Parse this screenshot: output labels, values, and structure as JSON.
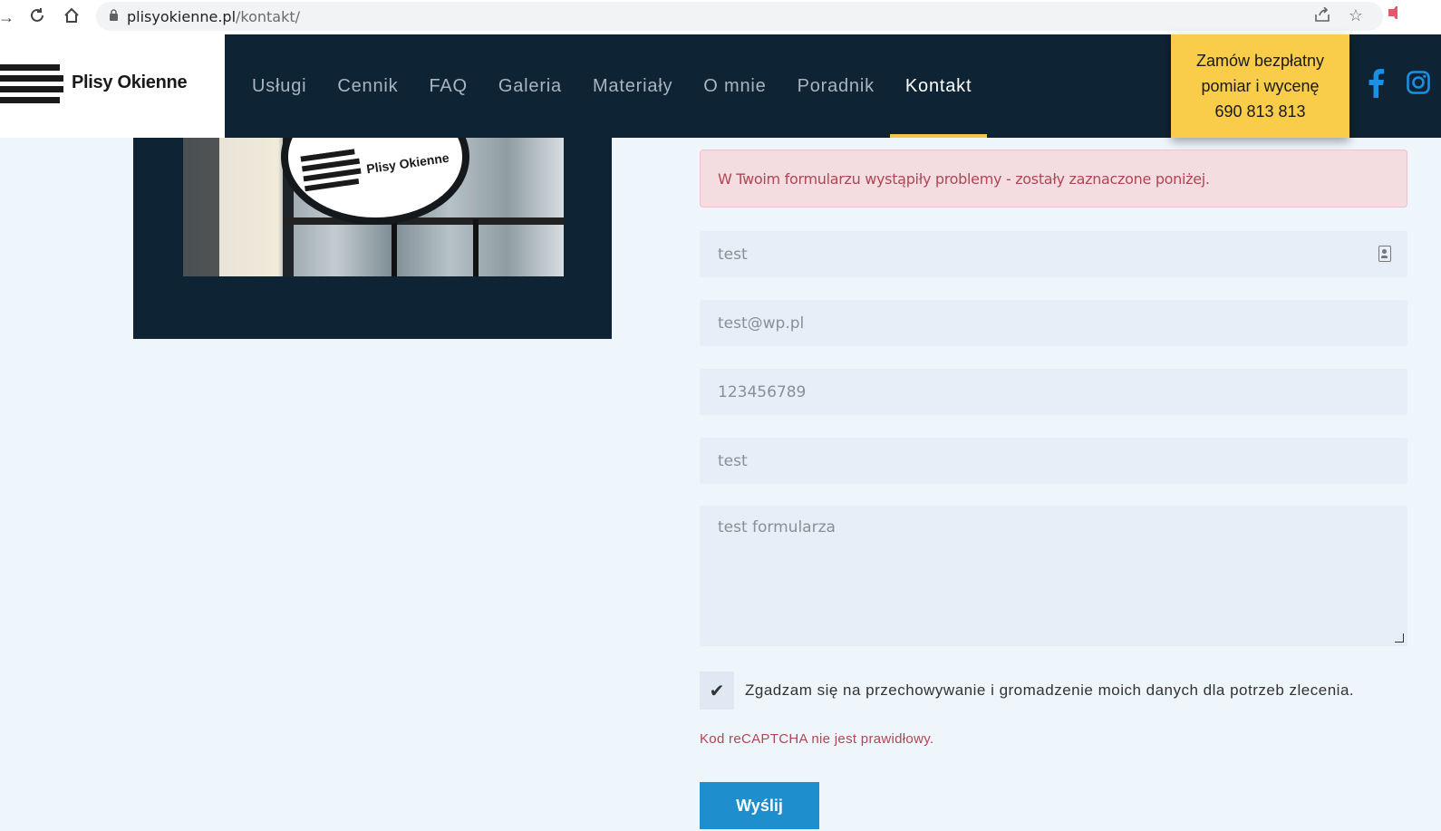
{
  "browser": {
    "url_host": "plisyokienne.pl",
    "url_path": "/kontakt/"
  },
  "header": {
    "logo_text": "Plisy Okienne",
    "nav": [
      {
        "label": "Usługi",
        "active": false
      },
      {
        "label": "Cennik",
        "active": false
      },
      {
        "label": "FAQ",
        "active": false
      },
      {
        "label": "Galeria",
        "active": false
      },
      {
        "label": "Materiały",
        "active": false
      },
      {
        "label": "O mnie",
        "active": false
      },
      {
        "label": "Poradnik",
        "active": false
      },
      {
        "label": "Kontakt",
        "active": true
      }
    ],
    "cta_line1": "Zamów bezpłatny",
    "cta_line2": "pomiar i wycenę",
    "cta_phone": "690 813 813"
  },
  "panel": {
    "sign_text": "Plisy Okienne"
  },
  "form": {
    "alert": "W Twoim formularzu wystąpiły problemy - zostały zaznaczone poniżej.",
    "name_value": "test",
    "email_value": "test@wp.pl",
    "phone_value": "123456789",
    "subject_value": "test",
    "message_value": "test formularza",
    "consent_label": "Zgadzam się na przechowywanie i gromadzenie moich danych dla potrzeb zlecenia.",
    "consent_checked": true,
    "captcha_error": "Kod reCAPTCHA nie jest prawidłowy.",
    "submit_label": "Wyślij"
  },
  "colors": {
    "header_bg": "#0e2334",
    "cta_bg": "#f9cc4a",
    "accent": "#f5c842",
    "submit_bg": "#1e8fcc",
    "error_text": "#b14554",
    "facebook": "#1b8fe0",
    "instagram": "#1b8fe0"
  }
}
